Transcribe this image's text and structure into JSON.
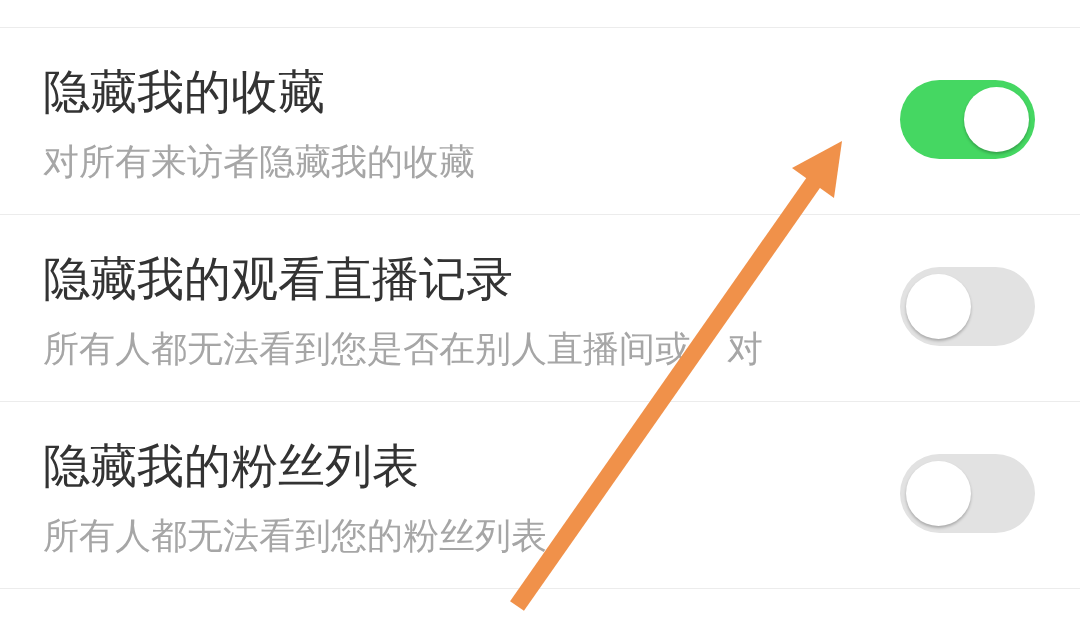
{
  "settings": [
    {
      "title": "隐藏我的收藏",
      "description": [
        "对所有来访者隐藏我的收藏"
      ],
      "on": true
    },
    {
      "title": "隐藏我的观看直播记录",
      "description": [
        "所有人都无法看到您是否在别人直播间或",
        "对"
      ],
      "on": false
    },
    {
      "title": "隐藏我的粉丝列表",
      "description": [
        "所有人都无法看到您的粉丝列表"
      ],
      "on": false
    }
  ]
}
